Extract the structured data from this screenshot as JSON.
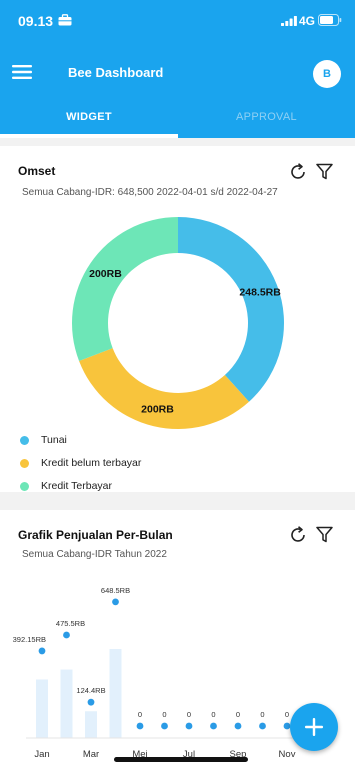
{
  "status_bar": {
    "time": "09.13",
    "network": "4G"
  },
  "header": {
    "title": "Bee Dashboard",
    "avatar_initial": "B"
  },
  "tabs": [
    {
      "label": "WIDGET",
      "active": true
    },
    {
      "label": "APPROVAL",
      "active": false
    }
  ],
  "colors": {
    "primary": "#1aa4ee",
    "tunai": "#45bde9",
    "kredit_belum": "#f8c43c",
    "kredit_terbayar": "#6de6b7",
    "chart_point": "#2a9be6",
    "chart_bar": "#e2f0fc"
  },
  "omset": {
    "title": "Omset",
    "subtitle": "Semua Cabang-IDR: 648,500 2022-04-01 s/d 2022-04-27",
    "legend": [
      {
        "label": "Tunai",
        "color": "#45bde9"
      },
      {
        "label": "Kredit belum terbayar",
        "color": "#f8c43c"
      },
      {
        "label": "Kredit Terbayar",
        "color": "#6de6b7"
      }
    ]
  },
  "grafik": {
    "title": "Grafik Penjualan Per-Bulan",
    "subtitle": "Semua Cabang-IDR Tahun 2022"
  },
  "chart_data": [
    {
      "type": "pie",
      "variant": "donut",
      "labels": [
        "Tunai",
        "Kredit belum terbayar",
        "Kredit Terbayar"
      ],
      "values": [
        248.5,
        200,
        200
      ],
      "data_labels": [
        "248.5RB",
        "200RB",
        "200RB"
      ],
      "colors": [
        "#45bde9",
        "#f8c43c",
        "#6de6b7"
      ]
    },
    {
      "type": "scatter",
      "x": [
        "Jan",
        "Feb",
        "Mar",
        "Apr",
        "Mei",
        "Jun",
        "Jul",
        "Agu",
        "Sep",
        "Okt",
        "Nov"
      ],
      "x_tick_labels": [
        "Jan",
        "Mar",
        "Mei",
        "Jul",
        "Sep",
        "Nov"
      ],
      "values": [
        392.15,
        475.5,
        124.4,
        648.5,
        0,
        0,
        0,
        0,
        0,
        0,
        0
      ],
      "data_labels": [
        "392.15RB",
        "475.5RB",
        "124.4RB",
        "648.5RB",
        "0",
        "0",
        "0",
        "0",
        "0",
        "0",
        "0"
      ],
      "ylim": [
        0,
        700
      ]
    }
  ]
}
